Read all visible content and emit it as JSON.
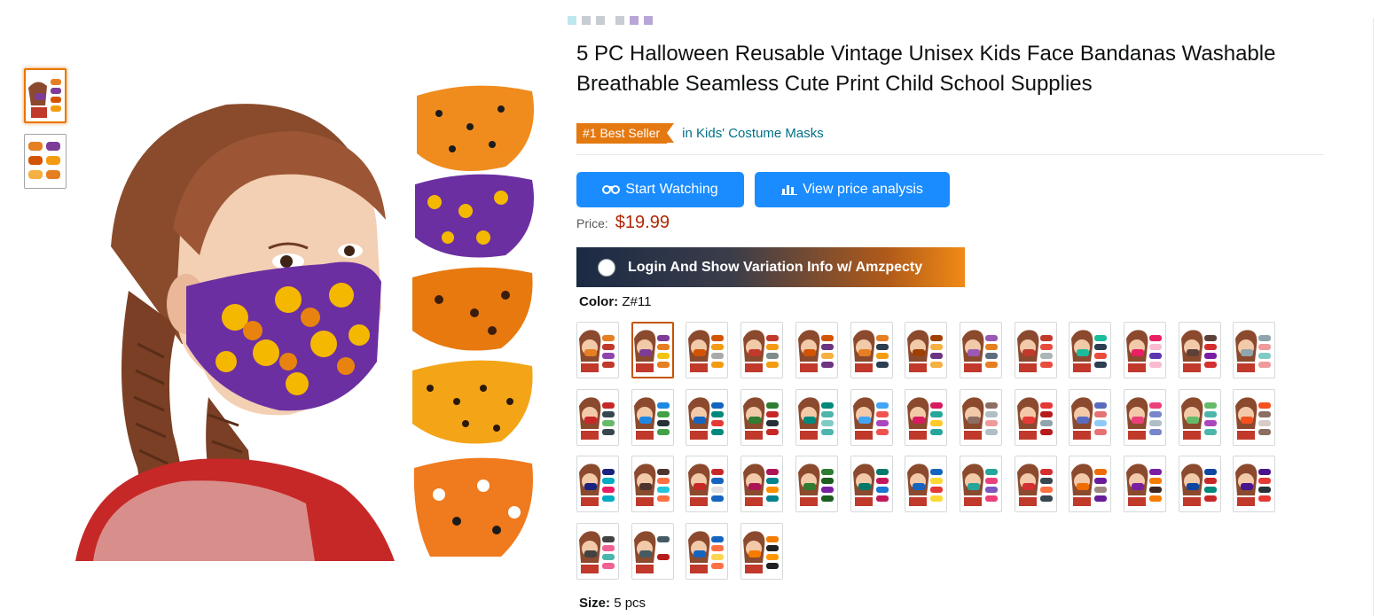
{
  "product": {
    "title": "5 PC Halloween Reusable Vintage Unisex Kids Face Bandanas Washable Breathable Seamless Cute Print Child School Supplies",
    "best_seller_badge": "#1 Best Seller",
    "best_seller_category": "in Kids' Costume Masks",
    "price_label": "Price:",
    "price_value": "$19.99"
  },
  "extension": {
    "watch_button": "Start Watching",
    "price_analysis_button": "View price analysis",
    "login_banner": "Login And Show Variation Info w/ Amzpecty",
    "icons": {
      "watch": "binoculars-icon",
      "analysis": "bar-chart-icon"
    },
    "colors": {
      "button": "#1a8cff"
    }
  },
  "variation": {
    "color_label": "Color:",
    "color_value": "Z#11",
    "size_label": "Size:",
    "size_value": "5 pcs",
    "swatch_count": 43,
    "selected_swatch_index": 1,
    "swatch_palettes": [
      [
        "#e67e22",
        "#c0392b",
        "#8e44ad"
      ],
      [
        "#7d3c98",
        "#e67e22",
        "#f1c40f"
      ],
      [
        "#d35400",
        "#f39c12",
        "#aaaaaa"
      ],
      [
        "#c0392b",
        "#f39c12",
        "#7f8c8d"
      ],
      [
        "#d35400",
        "#6c3483",
        "#f5b041"
      ],
      [
        "#e67e22",
        "#2c3e50",
        "#f39c12"
      ],
      [
        "#a04000",
        "#f5b041",
        "#6c3483"
      ],
      [
        "#9b59b6",
        "#e67e22",
        "#5d6d7e"
      ],
      [
        "#c0392b",
        "#e74c3c",
        "#aab7b8"
      ],
      [
        "#1abc9c",
        "#2c3e50",
        "#e74c3c"
      ],
      [
        "#e91e63",
        "#f8bbd0",
        "#5e35b1"
      ],
      [
        "#5d4037",
        "#d32f2f",
        "#7b1fa2"
      ],
      [
        "#90a4ae",
        "#ef9a9a",
        "#80cbc4"
      ],
      [
        "#c62828",
        "#37474f",
        "#66bb6a"
      ],
      [
        "#1e88e5",
        "#43a047",
        "#263238"
      ],
      [
        "#1565c0",
        "#00897b",
        "#e53935"
      ],
      [
        "#2e7d32",
        "#c62828",
        "#263238"
      ],
      [
        "#00897b",
        "#4db6ac",
        "#80cbc4"
      ],
      [
        "#42a5f5",
        "#ef5350",
        "#ab47bc"
      ],
      [
        "#d81b60",
        "#26a69a",
        "#ffca28"
      ],
      [
        "#8d6e63",
        "#b0bec5",
        "#ef9a9a"
      ],
      [
        "#e53935",
        "#b71c1c",
        "#90a4ae"
      ],
      [
        "#5c6bc0",
        "#e57373",
        "#90caf9"
      ],
      [
        "#ec407a",
        "#7986cb",
        "#b0bec5"
      ],
      [
        "#66bb6a",
        "#4db6ac",
        "#ab47bc"
      ],
      [
        "#f4511e",
        "#8d6e63",
        "#d7ccc8"
      ],
      [
        "#1a237e",
        "#00acc1",
        "#e91e63"
      ],
      [
        "#4e342e",
        "#ff7043",
        "#26c6da"
      ],
      [
        "#c62828",
        "#1565c0",
        "#e0e0e0"
      ],
      [
        "#ad1457",
        "#00838f",
        "#ff8f00"
      ],
      [
        "#2e7d32",
        "#1b5e20",
        "#7b1fa2"
      ],
      [
        "#00796b",
        "#c2185b",
        "#1976d2"
      ],
      [
        "#1565c0",
        "#fdd835",
        "#e53935"
      ],
      [
        "#26a69a",
        "#ec407a",
        "#7e57c2"
      ],
      [
        "#d32f2f",
        "#37474f",
        "#ff7043"
      ],
      [
        "#ef6c00",
        "#6a1b9a",
        "#a1887f"
      ],
      [
        "#7b1fa2",
        "#f57c00",
        "#3e2723"
      ],
      [
        "#0d47a1",
        "#c62828",
        "#00897b"
      ],
      [
        "#4a148c",
        "#e53935",
        "#263238"
      ],
      [
        "#424242",
        "#f06292",
        "#4db6ac"
      ],
      [
        "#455a64",
        "#ffffff",
        "#b71c1c"
      ],
      [
        "#1565c0",
        "#ff7043",
        "#ffd54f"
      ],
      [
        "#f57c00",
        "#212121",
        "#ff9800"
      ]
    ]
  }
}
